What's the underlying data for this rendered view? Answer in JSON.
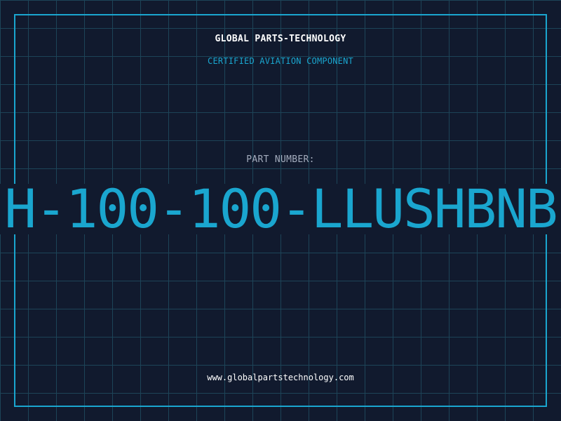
{
  "brand": {
    "name": "GLOBAL PARTS-TECHNOLOGY",
    "tagline": "CERTIFIED AVIATION COMPONENT"
  },
  "part": {
    "label": "PART NUMBER:",
    "number": "H-100-100-LLUSHBNB"
  },
  "footer": {
    "website": "www.globalpartstechnology.com"
  },
  "colors": {
    "background": "#111a2e",
    "grid": "#1d4458",
    "accent": "#1aa6cf",
    "text": "#ffffff",
    "muted": "#a3acbd"
  }
}
